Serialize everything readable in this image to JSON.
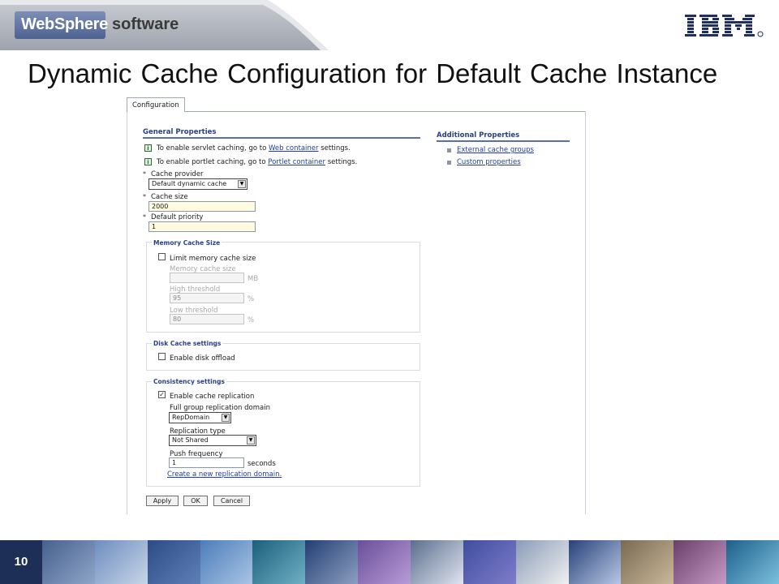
{
  "header": {
    "brand_primary": "WebSphere",
    "brand_secondary": "software",
    "vendor_logo": "IBM",
    "brand_color": "#5b6f9a"
  },
  "slide": {
    "title": "Dynamic Cache Configuration for Default Cache Instance",
    "page_number": "10"
  },
  "panel": {
    "tab_label": "Configuration",
    "general": {
      "heading": "General Properties",
      "servlet_info": {
        "prefix": "To enable servlet caching, go to",
        "link": "Web container",
        "suffix": "settings."
      },
      "portlet_info": {
        "prefix": "To enable portlet caching, go to",
        "link": "Portlet container",
        "suffix": "settings."
      },
      "cache_provider": {
        "label": "Cache provider",
        "value": "Default dynamic cache"
      },
      "cache_size": {
        "label": "Cache size",
        "value": "2000"
      },
      "default_priority": {
        "label": "Default priority",
        "value": "1"
      }
    },
    "memory": {
      "title": "Memory Cache Size",
      "limit_label": "Limit memory cache size",
      "limit_checked": false,
      "size_label": "Memory cache size",
      "size_value": "",
      "size_unit": "MB",
      "high_label": "High threshold",
      "high_value": "95",
      "high_unit": "%",
      "low_label": "Low threshold",
      "low_value": "80",
      "low_unit": "%"
    },
    "disk": {
      "title": "Disk Cache settings",
      "offload_label": "Enable disk offload",
      "offload_checked": false
    },
    "consistency": {
      "title": "Consistency settings",
      "replication_label": "Enable cache replication",
      "replication_checked": true,
      "domain_label": "Full group replication domain",
      "domain_value": "RepDomain",
      "type_label": "Replication type",
      "type_value": "Not Shared",
      "push_label": "Push frequency",
      "push_value": "1",
      "push_unit": "seconds",
      "create_link": "Create a new replication domain."
    },
    "buttons": {
      "apply": "Apply",
      "ok": "OK",
      "cancel": "Cancel"
    },
    "additional": {
      "heading": "Additional Properties",
      "items": [
        "External cache groups",
        "Custom properties"
      ]
    }
  }
}
